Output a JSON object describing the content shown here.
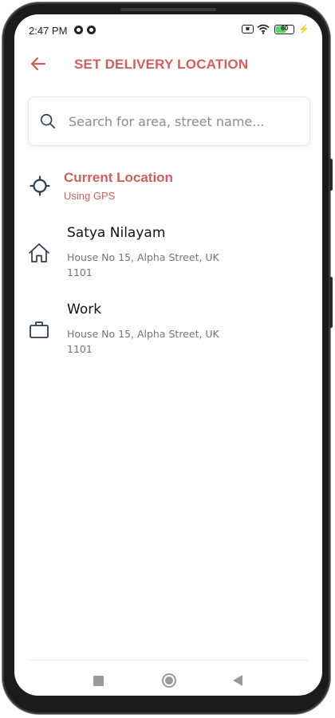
{
  "status_bar": {
    "time": "2:47 PM",
    "battery_level": "60",
    "battery_percent": 60
  },
  "header": {
    "title": "SET DELIVERY LOCATION"
  },
  "search": {
    "placeholder": "Search for area, street name..."
  },
  "current_location": {
    "title": "Current Location",
    "subtitle": "Using GPS"
  },
  "saved_addresses": [
    {
      "name": "Satya Nilayam",
      "address": "House No 15, Alpha Street, UK 1101",
      "icon": "home-icon"
    },
    {
      "name": "Work",
      "address": "House No 15, Alpha Street, UK 1101",
      "icon": "briefcase-icon"
    }
  ],
  "colors": {
    "accent": "#d35d5d",
    "icon": "#2f3b52",
    "secondary_text": "#757575",
    "battery": "#4cd964"
  }
}
